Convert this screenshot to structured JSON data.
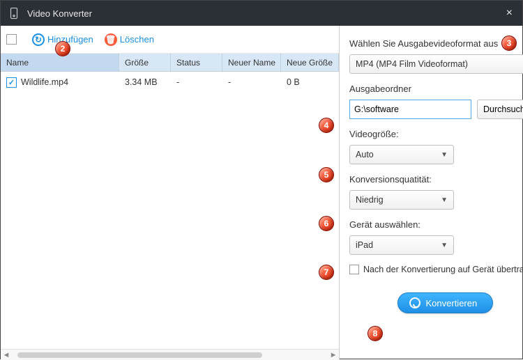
{
  "titlebar": {
    "title": "Video Konverter"
  },
  "toolbar": {
    "add_label": "Hinzufügen",
    "del_label": "Löschen"
  },
  "table": {
    "headers": {
      "name": "Name",
      "size": "Größe",
      "status": "Status",
      "newname": "Neuer Name",
      "newsize": "Neue Größe"
    },
    "row": {
      "name": "Wildlife.mp4",
      "size": "3.34 MB",
      "status": "-",
      "newname": "-",
      "newsize": "0 B"
    }
  },
  "right": {
    "format_label": "Wählen Sie Ausgabevideoformat aus",
    "format_value": "MP4 (MP4 Film Videoformat)",
    "folder_label": "Ausgabeordner",
    "folder_value": "G:\\software",
    "browse": "Durchsuchen",
    "size_label": "Videogröße:",
    "size_value": "Auto",
    "quality_label": "Konversionsquatität:",
    "quality_value": "Niedrig",
    "device_label": "Gerät auswählen:",
    "device_value": "iPad",
    "transfer_label": "Nach der Konvertierung auf Gerät übertragen",
    "convert": "Konvertieren"
  },
  "badges": {
    "b2": "2",
    "b3": "3",
    "b4": "4",
    "b5": "5",
    "b6": "6",
    "b7": "7",
    "b8": "8"
  }
}
